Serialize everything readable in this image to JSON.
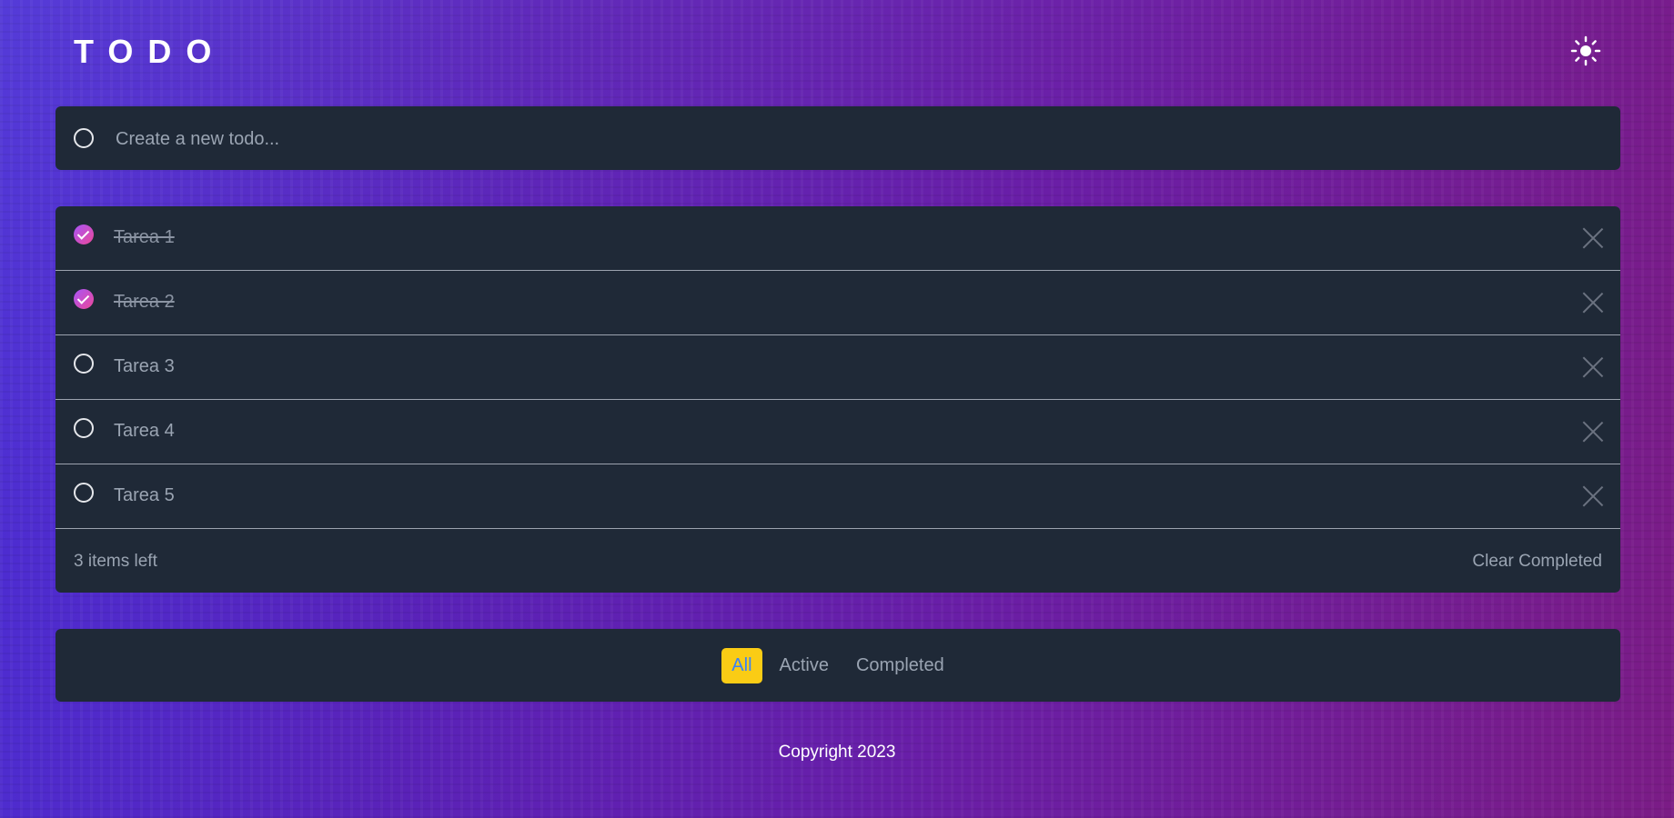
{
  "header": {
    "title": "TODO",
    "theme_icon": "sun-icon"
  },
  "new_todo": {
    "placeholder": "Create a new todo...",
    "value": ""
  },
  "todos": [
    {
      "label": "Tarea 1",
      "completed": true
    },
    {
      "label": "Tarea 2",
      "completed": true
    },
    {
      "label": "Tarea 3",
      "completed": false
    },
    {
      "label": "Tarea 4",
      "completed": false
    },
    {
      "label": "Tarea 5",
      "completed": false
    }
  ],
  "list_footer": {
    "items_left": "3 items left",
    "clear_completed": "Clear Completed"
  },
  "filters": {
    "all": "All",
    "active": "Active",
    "completed": "Completed",
    "selected": "all"
  },
  "footer": {
    "copyright": "Copyright 2023"
  },
  "colors": {
    "card_bg": "#1f2937",
    "accent_yellow": "#facc15",
    "active_filter_text": "#3b82f6",
    "check_gradient_start": "#a855f7",
    "check_gradient_end": "#ec4899"
  }
}
